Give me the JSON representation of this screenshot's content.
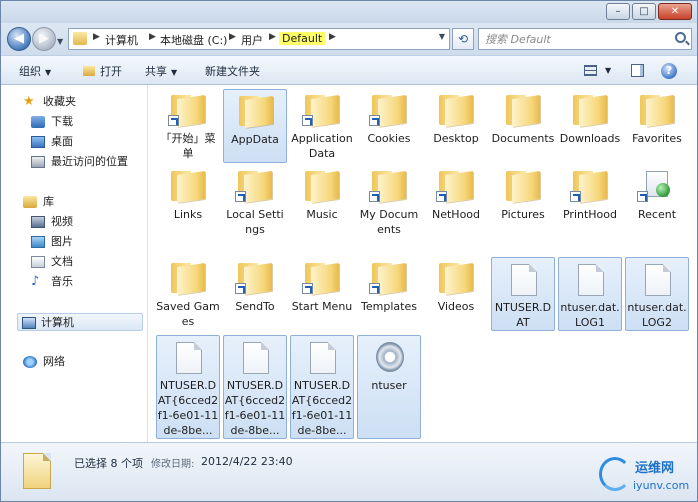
{
  "window": {
    "controls": {
      "minimize": "–",
      "maximize": "□",
      "close": "✕"
    }
  },
  "address": {
    "crumbs": [
      "计算机",
      "本地磁盘 (C:)",
      "用户",
      "Default"
    ],
    "search_placeholder": "搜索 Default"
  },
  "toolbar": {
    "organize": "组织",
    "open": "打开",
    "share": "共享",
    "new_folder": "新建文件夹"
  },
  "nav": {
    "favorites": "收藏夹",
    "downloads": "下载",
    "desktop": "桌面",
    "recent": "最近访问的位置",
    "libraries": "库",
    "videos": "视频",
    "pictures": "图片",
    "documents": "文档",
    "music": "音乐",
    "computer": "计算机",
    "network": "网络"
  },
  "files": [
    {
      "label": "「开始」菜单",
      "icon": "folder-shortcut-icon",
      "selected": false
    },
    {
      "label": "AppData",
      "icon": "folder-icon",
      "selected": true
    },
    {
      "label": "Application Data",
      "icon": "folder-shortcut-icon",
      "selected": false
    },
    {
      "label": "Cookies",
      "icon": "folder-shortcut-icon",
      "selected": false
    },
    {
      "label": "Desktop",
      "icon": "folder-icon",
      "selected": false
    },
    {
      "label": "Documents",
      "icon": "folder-icon",
      "selected": false
    },
    {
      "label": "Downloads",
      "icon": "folder-icon",
      "selected": false
    },
    {
      "label": "Favorites",
      "icon": "folder-icon",
      "selected": false
    },
    {
      "label": "Links",
      "icon": "folder-icon",
      "selected": false
    },
    {
      "label": "Local Settings",
      "icon": "folder-shortcut-icon",
      "selected": false
    },
    {
      "label": "Music",
      "icon": "folder-icon",
      "selected": false
    },
    {
      "label": "My Documents",
      "icon": "folder-shortcut-icon",
      "selected": false
    },
    {
      "label": "NetHood",
      "icon": "folder-shortcut-icon",
      "selected": false
    },
    {
      "label": "Pictures",
      "icon": "folder-icon",
      "selected": false
    },
    {
      "label": "PrintHood",
      "icon": "folder-shortcut-icon",
      "selected": false
    },
    {
      "label": "Recent",
      "icon": "favorites-shortcut-icon",
      "selected": false
    },
    {
      "label": "Saved Games",
      "icon": "folder-icon",
      "selected": false
    },
    {
      "label": "SendTo",
      "icon": "folder-shortcut-icon",
      "selected": false
    },
    {
      "label": "Start Menu",
      "icon": "folder-shortcut-icon",
      "selected": false
    },
    {
      "label": "Templates",
      "icon": "folder-shortcut-icon",
      "selected": false
    },
    {
      "label": "Videos",
      "icon": "folder-icon",
      "selected": false
    },
    {
      "label": "NTUSER.DAT",
      "icon": "file-icon",
      "selected": true
    },
    {
      "label": "ntuser.dat.LOG1",
      "icon": "file-icon",
      "selected": true
    },
    {
      "label": "ntuser.dat.LOG2",
      "icon": "file-icon",
      "selected": true
    },
    {
      "label": "NTUSER.DAT{6cced2f1-6e01-11de-8be...",
      "icon": "file-icon",
      "selected": true
    },
    {
      "label": "NTUSER.DAT{6cced2f1-6e01-11de-8be...",
      "icon": "file-icon",
      "selected": true
    },
    {
      "label": "NTUSER.DAT{6cced2f1-6e01-11de-8be...",
      "icon": "file-icon",
      "selected": true
    },
    {
      "label": "ntuser",
      "icon": "settings-file-icon",
      "selected": true
    }
  ],
  "status": {
    "selected_count": "已选择 8 个项",
    "modified_label": "修改日期:",
    "modified_value": "2012/4/22 23:40"
  },
  "watermark": {
    "cn": "运维网",
    "en": "iyunv.com"
  }
}
